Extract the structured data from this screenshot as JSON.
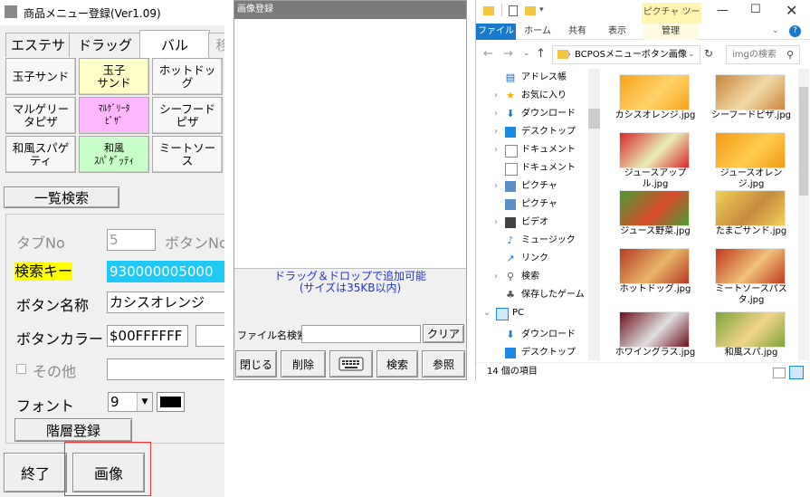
{
  "left_window": {
    "title": "商品メニュー登録(Ver1.09)",
    "tabs": [
      "エステサロン",
      "ドラッグ",
      "バル",
      "移"
    ],
    "menu_buttons": [
      {
        "label": "玉子サンド",
        "color": "#f7f7f7"
      },
      {
        "label": "玉子\nサンド",
        "color": "#ffffc8"
      },
      {
        "label": "ホットドッ\nグ",
        "color": "#f7f7f7"
      },
      {
        "label": "マルゲリー\nタピザ",
        "color": "#f7f7f7"
      },
      {
        "label": "ﾏﾙｹﾞﾘｰﾀ\nﾋﾟｻﾞ",
        "color": "#ffb8ff"
      },
      {
        "label": "シーフード\nピザ",
        "color": "#f7f7f7"
      },
      {
        "label": "和風スパゲ\nティ",
        "color": "#f7f7f7"
      },
      {
        "label": "和風\nｽﾊﾟｹﾞｯﾃｨ",
        "color": "#c8ffc8"
      },
      {
        "label": "ミートソー\nス",
        "color": "#f7f7f7"
      }
    ],
    "list_search_button": "一覧検索",
    "tab_no_label": "タブNo",
    "tab_no_value": "5",
    "button_no_label": "ボタンNo",
    "search_key_label": "検索キー",
    "search_key_value": "930000005000",
    "button_name_label": "ボタン名称",
    "button_name_value": "カシスオレンジ",
    "button_color_label": "ボタンカラー",
    "button_color_value": "$00FFFFFF",
    "other_label": "その他",
    "font_label": "フォント",
    "font_size": "9",
    "font_color": "#000000",
    "hierarchy_button": "階層登録",
    "end_button": "終了",
    "image_button": "画像"
  },
  "middle_window": {
    "title": "画像登録",
    "hint_line1": "ドラッグ＆ドロップで追加可能",
    "hint_line2": "(サイズは35KB以内)",
    "filename_search_label": "ファイル名検索",
    "filename_search_value": "",
    "clear_button": "クリア",
    "close_button": "閉じる",
    "delete_button": "削除",
    "keyboard_icon": "keyboard-icon",
    "search_button": "検索",
    "browse_button": "参照"
  },
  "explorer": {
    "context_tab": "ピクチャ ツール",
    "ribbon_tabs": [
      "ファイル",
      "ホーム",
      "共有",
      "表示",
      "管理"
    ],
    "address": "BCPOSメニューボタン画像",
    "search_placeholder": "imgの検索",
    "nav_items": [
      {
        "label": "アドレス帳",
        "icon": "address-book-icon",
        "chevron": ""
      },
      {
        "label": "お気に入り",
        "icon": "star-icon",
        "chevron": "›"
      },
      {
        "label": "ダウンロード",
        "icon": "download-icon",
        "chevron": "›"
      },
      {
        "label": "デスクトップ",
        "icon": "desktop-icon",
        "chevron": "›"
      },
      {
        "label": "ドキュメント",
        "icon": "document-icon",
        "chevron": "›"
      },
      {
        "label": "ドキュメント",
        "icon": "document-icon",
        "chevron": ""
      },
      {
        "label": "ピクチャ",
        "icon": "pictures-icon",
        "chevron": "›"
      },
      {
        "label": "ピクチャ",
        "icon": "pictures-icon",
        "chevron": ""
      },
      {
        "label": "ビデオ",
        "icon": "video-icon",
        "chevron": "›"
      },
      {
        "label": "ミュージック",
        "icon": "music-icon",
        "chevron": ""
      },
      {
        "label": "リンク",
        "icon": "link-icon",
        "chevron": ""
      },
      {
        "label": "検索",
        "icon": "search-icon",
        "chevron": "›"
      },
      {
        "label": "保存したゲーム",
        "icon": "game-icon",
        "chevron": ""
      },
      {
        "label": "PC",
        "icon": "pc-icon",
        "chevron": "⌄"
      },
      {
        "label": "ダウンロード",
        "icon": "download-icon",
        "chevron": ""
      },
      {
        "label": "デスクトップ",
        "icon": "desktop-icon",
        "chevron": ""
      }
    ],
    "files": [
      {
        "name": "カシスオレンジ.jpg",
        "c1": "#f7a21b",
        "c2": "#ffd36b"
      },
      {
        "name": "シーフードピザ.jpg",
        "c1": "#c9863e",
        "c2": "#f0d9a8"
      },
      {
        "name": "ジュースアップル.jpg",
        "c1": "#d9262b",
        "c2": "#e9efb3"
      },
      {
        "name": "ジュースオレンジ.jpg",
        "c1": "#f39a15",
        "c2": "#ffcb4f"
      },
      {
        "name": "ジュース野菜.jpg",
        "c1": "#4a9c35",
        "c2": "#d94a2a"
      },
      {
        "name": "たまごサンド.jpg",
        "c1": "#f1d25a",
        "c2": "#c58a3d"
      },
      {
        "name": "ホットドッグ.jpg",
        "c1": "#b53a22",
        "c2": "#e8b56a"
      },
      {
        "name": "ミートソースパスタ.jpg",
        "c1": "#c0391b",
        "c2": "#f0c27a"
      },
      {
        "name": "ホワイングラス.jpg",
        "c1": "#6b0f1a",
        "c2": "#e0e0e0"
      },
      {
        "name": "和風スパ.jpg",
        "c1": "#7ea33a",
        "c2": "#f2d38a"
      }
    ],
    "status": "14 個の項目"
  }
}
